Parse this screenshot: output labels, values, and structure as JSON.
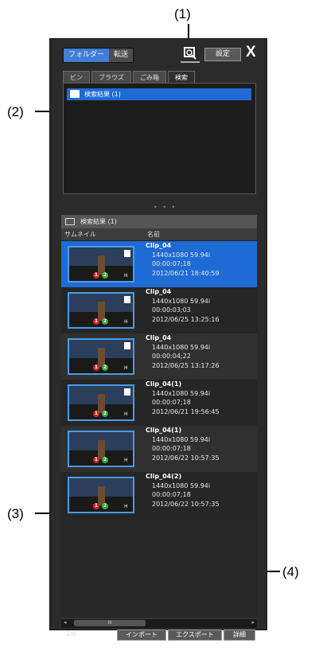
{
  "callouts": {
    "c1": "(1)",
    "c2": "(2)",
    "c3": "(3)",
    "c4": "(4)"
  },
  "topbar": {
    "folder_label": "フォルダー",
    "transfer_label": "転送",
    "settings_label": "設定",
    "close_label": "X"
  },
  "tabs": [
    {
      "label": "ビン"
    },
    {
      "label": "ブラウズ"
    },
    {
      "label": "ごみ箱"
    },
    {
      "label": "検索"
    }
  ],
  "tree": {
    "item_label": "検索結果 (1)"
  },
  "list": {
    "header_label": "検索結果 (1)",
    "columns": {
      "thumbnail": "サムネイル",
      "name": "名前"
    },
    "rows": [
      {
        "name": "Clip_04",
        "format": "1440x1080 59.94i",
        "duration": "00:00:07;18",
        "date": "2012/06/21 18:40:59"
      },
      {
        "name": "Clip_04",
        "format": "1440x1080 59.94i",
        "duration": "00:00:03;03",
        "date": "2012/06/25 13:25:16"
      },
      {
        "name": "Clip_04",
        "format": "1440x1080 59.94i",
        "duration": "00:00:04;22",
        "date": "2012/06/25 13:17:26"
      },
      {
        "name": "Clip_04(1)",
        "format": "1440x1080 59.94i",
        "duration": "00:00:07;18",
        "date": "2012/06/21 19:56:45"
      },
      {
        "name": "Clip_04(1)",
        "format": "1440x1080 59.94i",
        "duration": "00:00:07;18",
        "date": "2012/06/22 10:57:35"
      },
      {
        "name": "Clip_04(2)",
        "format": "1440x1080 59.94i",
        "duration": "00:00:07;18",
        "date": "2012/06/22 10:57:35"
      }
    ],
    "badges": {
      "one": "1",
      "two": "2",
      "h": "H"
    },
    "scroll_thumb": "III"
  },
  "footer": {
    "count": "1/6",
    "import_label": "インポート",
    "export_label": "エクスポート",
    "detail_label": "詳細"
  }
}
